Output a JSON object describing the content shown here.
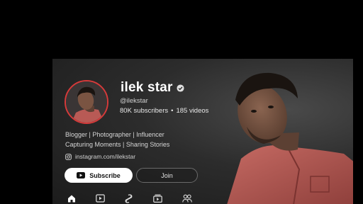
{
  "channel": {
    "name": "ilek star",
    "handle": "@ilekstar",
    "subscribers": "80K subscribers",
    "separator": "•",
    "videos": "185 videos",
    "bio_line1": "Blogger | Photographer | Influencer",
    "bio_line2": "Capturing Moments | Sharing Stories",
    "link": "instagram.com/ilekstar"
  },
  "buttons": {
    "subscribe": "Subscribe",
    "join": "Join"
  },
  "nav": {
    "icons": [
      "home-icon",
      "videos-icon",
      "shorts-icon",
      "playlists-icon",
      "community-icon"
    ]
  },
  "colors": {
    "avatar_ring": "#d63a3a",
    "shirt": "#b85a55",
    "background": "#000000"
  }
}
